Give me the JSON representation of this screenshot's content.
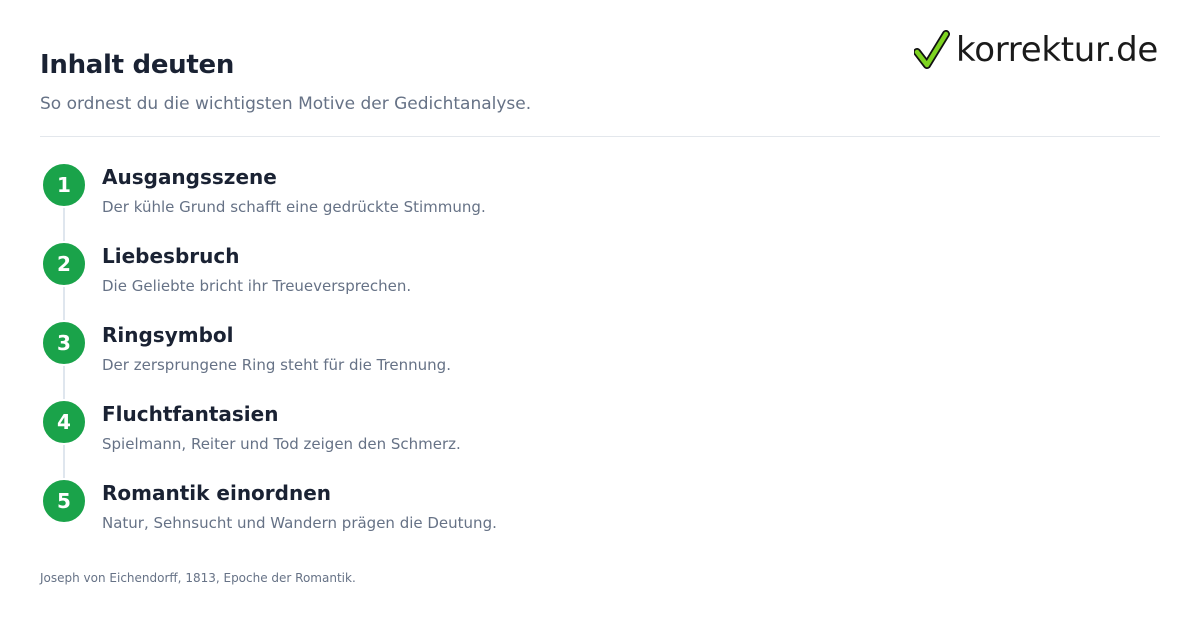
{
  "header": {
    "title": "Inhalt deuten",
    "subtitle": "So ordnest du die wichtigsten Motive der Gedichtanalyse."
  },
  "logo": {
    "text": "korrektur.de",
    "icon": "checkmark-icon",
    "check_color": "#7ed321"
  },
  "accent_color": "#1aa34a",
  "steps": [
    {
      "number": "1",
      "title": "Ausgangsszene",
      "description": "Der kühle Grund schafft eine gedrückte Stimmung."
    },
    {
      "number": "2",
      "title": "Liebesbruch",
      "description": "Die Geliebte bricht ihr Treueversprechen."
    },
    {
      "number": "3",
      "title": "Ringsymbol",
      "description": "Der zersprungene Ring steht für die Trennung."
    },
    {
      "number": "4",
      "title": "Fluchtfantasien",
      "description": "Spielmann, Reiter und Tod zeigen den Schmerz."
    },
    {
      "number": "5",
      "title": "Romantik einordnen",
      "description": "Natur, Sehnsucht und Wandern prägen die Deutung."
    }
  ],
  "footnote": "Joseph von Eichendorff, 1813, Epoche der Romantik."
}
